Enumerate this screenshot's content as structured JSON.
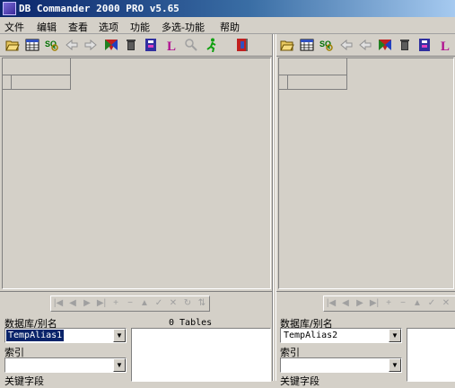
{
  "window": {
    "title": "DB Commander 2000 PRO v5.65"
  },
  "menu": [
    "文件",
    "编辑",
    "查看",
    "选项",
    "功能",
    "多选-功能",
    "帮助"
  ],
  "left": {
    "tables_count": "0 Tables",
    "db_label": "数据库/别名",
    "db_value": "TempAlias1",
    "index_label": "索引",
    "index_value": "",
    "keyfield_label": "关键字段"
  },
  "right": {
    "db_label": "数据库/别名",
    "db_value": "TempAlias2",
    "index_label": "索引",
    "index_value": "",
    "keyfield_label": "关键字段"
  },
  "nav_glyphs": [
    "|◀",
    "◀",
    "▶",
    "▶|",
    "+",
    "−",
    "▲",
    "✓",
    "✕",
    "↻",
    "⇅"
  ]
}
